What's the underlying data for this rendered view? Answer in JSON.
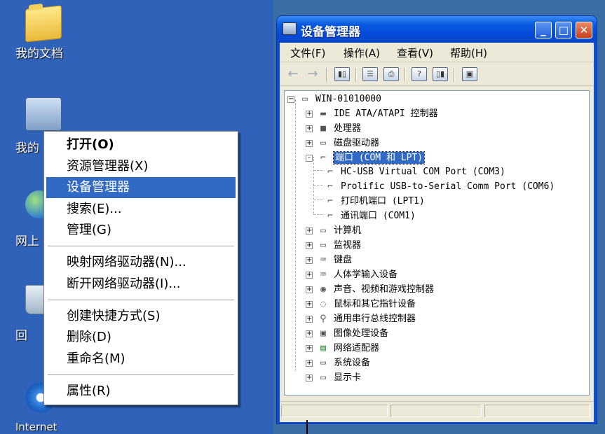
{
  "desktop": {
    "icons": [
      {
        "label": "我的文档",
        "icon": "my-documents-folder-icon"
      },
      {
        "label": "我的",
        "icon": "my-computer-icon"
      },
      {
        "label": "网上",
        "icon": "network-places-icon"
      },
      {
        "label": "回",
        "icon": "recycle-bin-icon"
      },
      {
        "label": "Internet",
        "icon": "internet-explorer-icon"
      }
    ]
  },
  "context_menu": {
    "items": [
      {
        "label": "打开(O)"
      },
      {
        "label": "资源管理器(X)"
      },
      {
        "label": "设备管理器"
      },
      {
        "label": "搜索(E)..."
      },
      {
        "label": "管理(G)"
      },
      {
        "label": "映射网络驱动器(N)..."
      },
      {
        "label": "断开网络驱动器(I)..."
      },
      {
        "label": "创建快捷方式(S)"
      },
      {
        "label": "删除(D)"
      },
      {
        "label": "重命名(M)"
      },
      {
        "label": "属性(R)"
      }
    ],
    "highlighted": "设备管理器",
    "highlight_color": "#316ac5"
  },
  "window": {
    "title": "设备管理器",
    "controls": {
      "minimize": "_",
      "maximize": "□",
      "close": "✕"
    },
    "menu": [
      "文件(F)",
      "操作(A)",
      "查看(V)",
      "帮助(H)"
    ],
    "toolbar_icons": [
      "back-arrow-icon",
      "forward-arrow-icon",
      "show-hide-tree-icon",
      "properties-icon",
      "print-icon",
      "help-icon",
      "show-pane-icon",
      "scan-hardware-icon"
    ],
    "tree": {
      "root": "WIN-01010000",
      "categories": [
        {
          "label": "IDE ATA/ATAPI 控制器",
          "icon": "ide-controller-icon",
          "expander": "+"
        },
        {
          "label": "处理器",
          "icon": "processor-chip-icon",
          "expander": "+"
        },
        {
          "label": "磁盘驱动器",
          "icon": "disk-drive-icon",
          "expander": "+"
        },
        {
          "label": "端口 (COM 和 LPT)",
          "icon": "port-connector-icon",
          "expander": "-",
          "selected": true,
          "children": [
            "HC-USB Virtual COM Port (COM3)",
            "Prolific USB-to-Serial Comm Port (COM6)",
            "打印机端口 (LPT1)",
            "通讯端口 (COM1)"
          ]
        },
        {
          "label": "计算机",
          "icon": "computer-icon",
          "expander": "+"
        },
        {
          "label": "监视器",
          "icon": "monitor-icon",
          "expander": "+"
        },
        {
          "label": "键盘",
          "icon": "keyboard-icon",
          "expander": "+"
        },
        {
          "label": "人体学输入设备",
          "icon": "hid-device-icon",
          "expander": "+"
        },
        {
          "label": "声音、视频和游戏控制器",
          "icon": "sound-icon",
          "expander": "+"
        },
        {
          "label": "鼠标和其它指针设备",
          "icon": "mouse-icon",
          "expander": "+"
        },
        {
          "label": "通用串行总线控制器",
          "icon": "usb-icon",
          "expander": "+"
        },
        {
          "label": "图像处理设备",
          "icon": "imaging-device-icon",
          "expander": "+"
        },
        {
          "label": "网络适配器",
          "icon": "network-adapter-icon",
          "expander": "+"
        },
        {
          "label": "系统设备",
          "icon": "system-device-icon",
          "expander": "+"
        },
        {
          "label": "显示卡",
          "icon": "display-adapter-icon",
          "expander": "+"
        }
      ]
    }
  },
  "colors": {
    "desktop": "#2f62b8",
    "titlebar": "#0b5be0",
    "selection": "#316ac5"
  }
}
